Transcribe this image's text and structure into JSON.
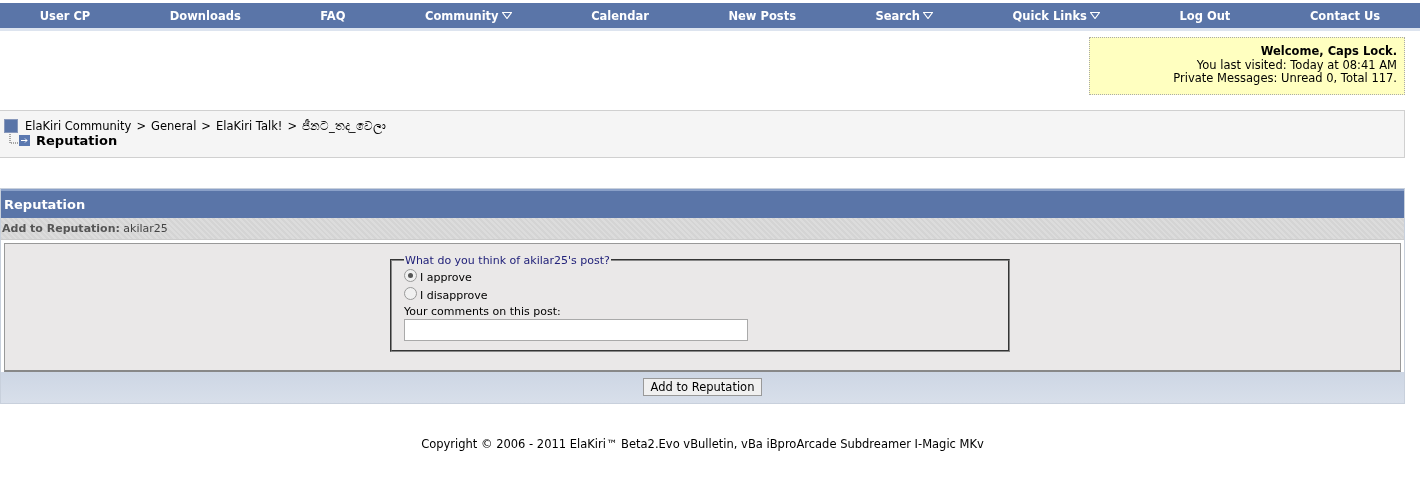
{
  "nav": [
    {
      "label": "User CP",
      "dropdown": false
    },
    {
      "label": "Downloads",
      "dropdown": false
    },
    {
      "label": "FAQ",
      "dropdown": false
    },
    {
      "label": "Community",
      "dropdown": true
    },
    {
      "label": "Calendar",
      "dropdown": false
    },
    {
      "label": "New Posts",
      "dropdown": false
    },
    {
      "label": "Search",
      "dropdown": true
    },
    {
      "label": "Quick Links",
      "dropdown": true
    },
    {
      "label": "Log Out",
      "dropdown": false
    },
    {
      "label": "Contact Us",
      "dropdown": false
    }
  ],
  "welcome": {
    "title": "Welcome, Caps Lock.",
    "last_visited": "You last visited: Today at 08:41 AM",
    "messages": "Private Messages: Unread 0, Total 117."
  },
  "breadcrumb": {
    "links": [
      "ElaKiri Community",
      "General",
      "ElaKiri Talk!",
      "ජීනට_තද_වෙලා"
    ],
    "separator": ">",
    "current": "Reputation"
  },
  "panel": {
    "title": "Reputation",
    "subtitle_label": "Add to Reputation:",
    "subtitle_user": "akilar25",
    "legend": "What do you think of akilar25's post?",
    "options": [
      {
        "label": "I approve",
        "selected": true
      },
      {
        "label": "I disapprove",
        "selected": false
      }
    ],
    "comment_label": "Your comments on this post:",
    "submit": "Add to Reputation"
  },
  "footer": "Copyright © 2006 - 2011 ElaKiri™ Beta2.Evo vBulletin, vBa iBproArcade Subdreamer I-Magic MKv"
}
